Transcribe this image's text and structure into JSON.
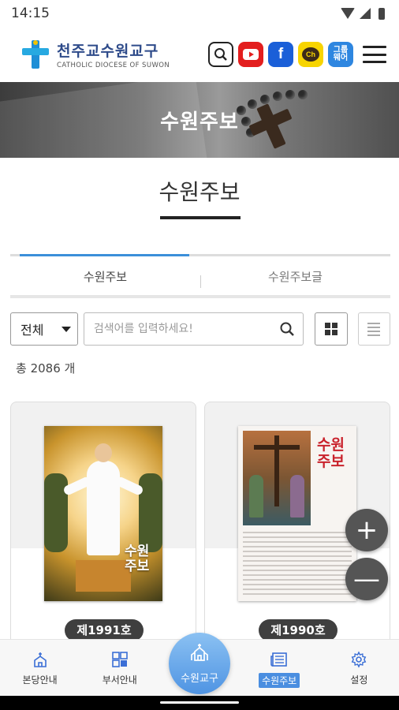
{
  "status_bar": {
    "time": "14:15"
  },
  "header": {
    "logo_title": "천주교수원교구",
    "logo_subtitle": "CATHOLIC DIOCESE OF SUWON",
    "facebook_glyph": "f",
    "kakao_glyph": "Ch",
    "groupware_label_line1": "그룹",
    "groupware_label_line2": "웨어"
  },
  "banner": {
    "title": "수원주보"
  },
  "page": {
    "title": "수원주보"
  },
  "tabs": [
    {
      "label": "수원주보",
      "active": true
    },
    {
      "label": "수원주보글",
      "active": false
    }
  ],
  "filter": {
    "select_value": "전체",
    "search_placeholder": "검색어를 입력하세요!"
  },
  "count_text": "총  2086 개",
  "cards": [
    {
      "issue": "제1991호",
      "cover_masthead_line1": "수원",
      "cover_masthead_line2": "주보"
    },
    {
      "issue": "제1990호",
      "cover_masthead_line1": "수원",
      "cover_masthead_line2": "주보"
    }
  ],
  "fab": {
    "zoom_in": "+",
    "zoom_out": "—"
  },
  "bottom_nav": [
    {
      "label": "본당안내",
      "icon": "church-icon"
    },
    {
      "label": "부서안내",
      "icon": "grid-icon"
    },
    {
      "label": "수원교구",
      "icon": "cathedral-icon"
    },
    {
      "label": "수원주보",
      "icon": "newspaper-icon",
      "selected": true
    },
    {
      "label": "설정",
      "icon": "gear-icon"
    }
  ],
  "colors": {
    "accent": "#3b8fd9",
    "youtube": "#e31e1e",
    "facebook": "#1a5fd8",
    "kakao": "#f7d400",
    "groupware": "#2e86e0",
    "center_nav": "#4f94e3"
  }
}
